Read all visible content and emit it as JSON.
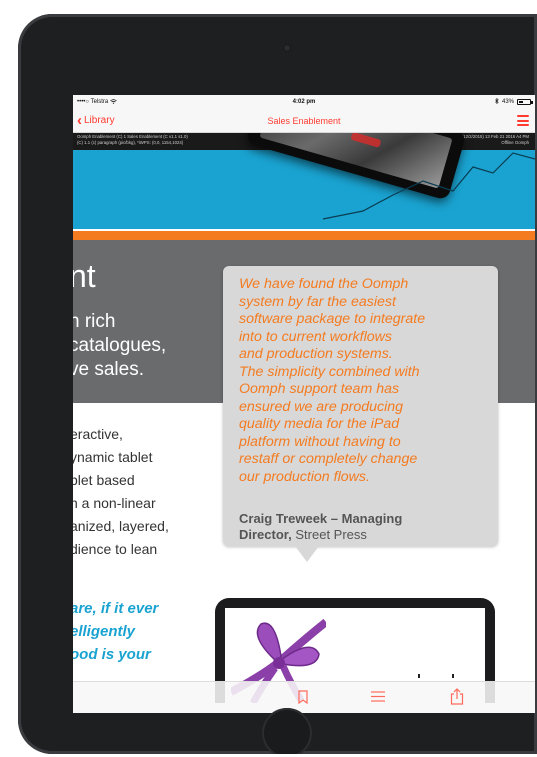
{
  "status_bar": {
    "carrier": "••••○ Telstra",
    "wifi_icon": "wifi-icon",
    "time": "4:02 pm",
    "battery_percent": "43%",
    "battery_level": 0.43
  },
  "nav": {
    "back_label": "Library",
    "title": "Sales Enablement",
    "menu_icon": "hamburger-menu-icon"
  },
  "hero": {
    "debug_left_1": "Oomph Enablement (C) 1 Sales Enablement (C v1.1 s1.0)",
    "debug_left_2": "(C) 1.1 (c) paragraph (pic/bkg), *iWPS: (0,0, 1154,1024)",
    "debug_right_1": "Oomph Viewer OA Build 1.1 (12/2/2015) 13 Feb 21 2016 A4 PM",
    "debug_right_2": "Offline Oomph"
  },
  "panel": {
    "heading_fragment": "nt",
    "line_1": "h rich",
    "line_2": "catalogues,",
    "line_3": "ve sales."
  },
  "body": {
    "lines": [
      "eractive,",
      "ynamic tablet",
      "blet based",
      "n a non-linear",
      "anized, layered,",
      "dience to lean"
    ],
    "highlight": [
      "are, if it ever",
      "elligently",
      "ood is your"
    ]
  },
  "quote": {
    "text": "We have found the Oomph\nsystem by far the easiest\nsoftware package to integrate\ninto to current workflows\nand production systems.\nThe simplicity combined with\nOomph support team has\nensured we are producing\nquality media for the iPad\nplatform without having to\nrestaff or completely change\nour production flows.",
    "author_name": "Craig Treweek – Managing",
    "author_role_prefix": "Director,",
    "author_company": "Street Press"
  },
  "toolbar": {
    "icons": [
      "bookmark-icon",
      "list-icon",
      "share-icon"
    ]
  },
  "colors": {
    "accent_red": "#ff3b30",
    "quote_orange": "#f47b20",
    "hero_blue": "#1aa3d1",
    "panel_gray": "#6a6b6d"
  }
}
